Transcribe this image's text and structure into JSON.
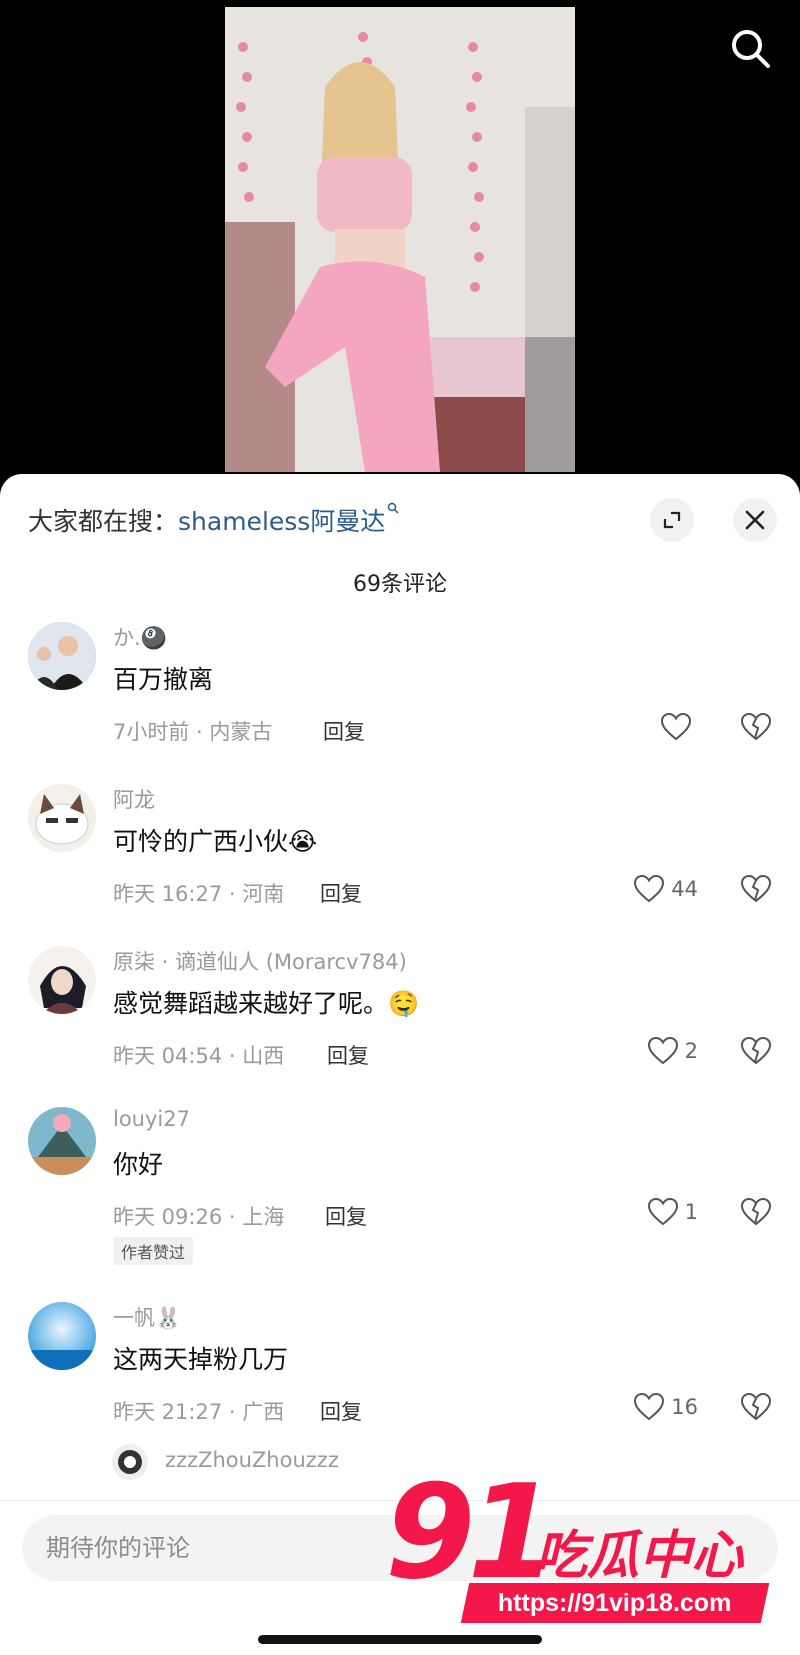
{
  "trending": {
    "prefix": "大家都在搜：",
    "keyword": "shameless阿曼达"
  },
  "comments_count": "69条评论",
  "comments": [
    {
      "username": "か.🎱",
      "text": "百万撤离",
      "meta": "7小时前 · 内蒙古",
      "reply": "回复",
      "likes": ""
    },
    {
      "username": "阿龙",
      "text": "可怜的广西小伙😭",
      "meta": "昨天 16:27 · 河南",
      "reply": "回复",
      "likes": "44"
    },
    {
      "username": "原柒 · 谪道仙人 (Morarcv784)",
      "text": "感觉舞蹈越来越好了呢。🤤",
      "meta": "昨天 04:54 · 山西",
      "reply": "回复",
      "likes": "2"
    },
    {
      "username": "louyi27",
      "text": "你好",
      "meta": "昨天 09:26 · 上海",
      "reply": "回复",
      "likes": "1",
      "badge": "作者赞过"
    },
    {
      "username": "一帆🐰",
      "text": "这两天掉粉几万",
      "meta": "昨天 21:27 · 广西",
      "reply": "回复",
      "likes": "16"
    }
  ],
  "sub_reply": {
    "username": "zzzZhouZhouzzz"
  },
  "input": {
    "placeholder": "期待你的评论"
  },
  "watermark": {
    "number": "91",
    "text": "吃瓜中心",
    "url": "https://91vip18.com"
  },
  "icons": {
    "search": "search-icon",
    "expand": "expand-icon",
    "close": "close-icon",
    "like": "heart-icon",
    "dislike": "broken-heart-icon"
  },
  "colors": {
    "keyword": "#2c5c8a",
    "watermark": "#f4184a"
  }
}
